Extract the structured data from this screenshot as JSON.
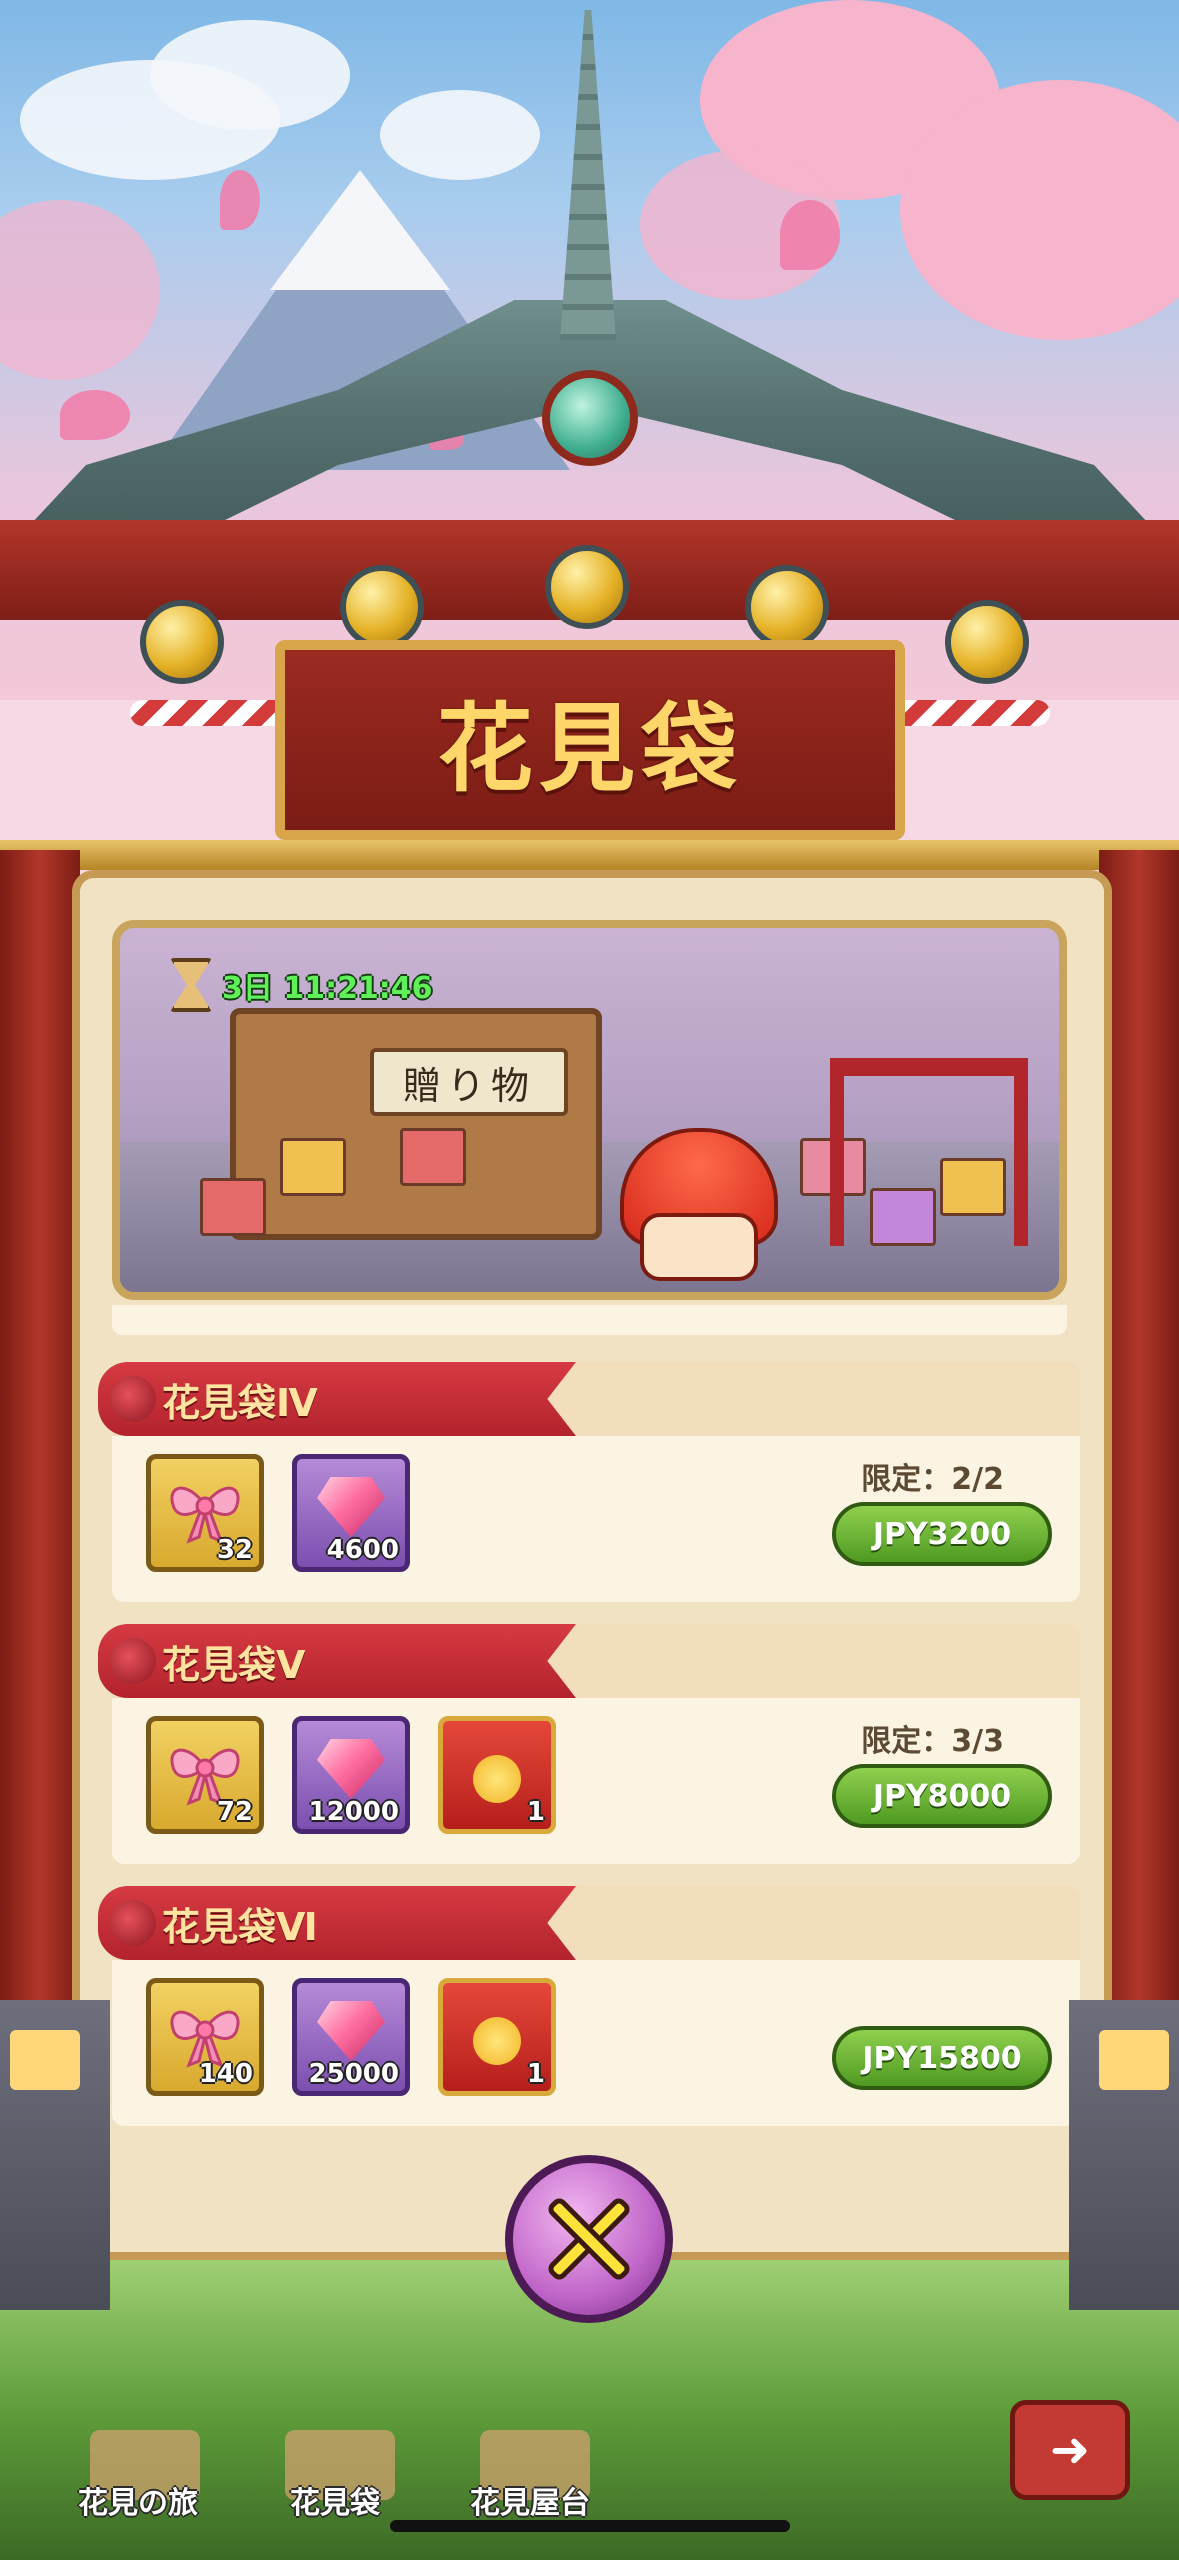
{
  "screen": {
    "title": "花見袋",
    "timer": "3日 11:21:46",
    "stall_sign": "贈り物"
  },
  "packs": [
    {
      "name": "花見袋Ⅳ",
      "items": [
        {
          "icon": "ribbon-bow-icon",
          "count": "32",
          "frame": "gold"
        },
        {
          "icon": "pink-gem-icon",
          "count": "4600",
          "frame": "purple"
        }
      ],
      "limit": "限定：2/2",
      "price": "JPY3200"
    },
    {
      "name": "花見袋Ⅴ",
      "items": [
        {
          "icon": "ribbon-bow-icon",
          "count": "72",
          "frame": "gold"
        },
        {
          "icon": "pink-gem-icon",
          "count": "12000",
          "frame": "purple"
        },
        {
          "icon": "red-envelope-icon",
          "count": "1",
          "frame": "red"
        }
      ],
      "limit": "限定：3/3",
      "price": "JPY8000"
    },
    {
      "name": "花見袋Ⅵ",
      "items": [
        {
          "icon": "ribbon-bow-icon",
          "count": "140",
          "frame": "gold"
        },
        {
          "icon": "pink-gem-icon",
          "count": "25000",
          "frame": "purple"
        },
        {
          "icon": "red-envelope-icon",
          "count": "1",
          "frame": "red"
        }
      ],
      "limit": "",
      "price": "JPY15800"
    }
  ],
  "tabs": [
    {
      "label": "花見の旅"
    },
    {
      "label": "花見袋"
    },
    {
      "label": "花見屋台"
    }
  ],
  "colors": {
    "ribbon_red": "#d63a42",
    "buy_green": "#5fae2c",
    "timer_green": "#5ff05a",
    "panel_cream": "#fbf4e2",
    "title_gold": "#ffd66a"
  }
}
